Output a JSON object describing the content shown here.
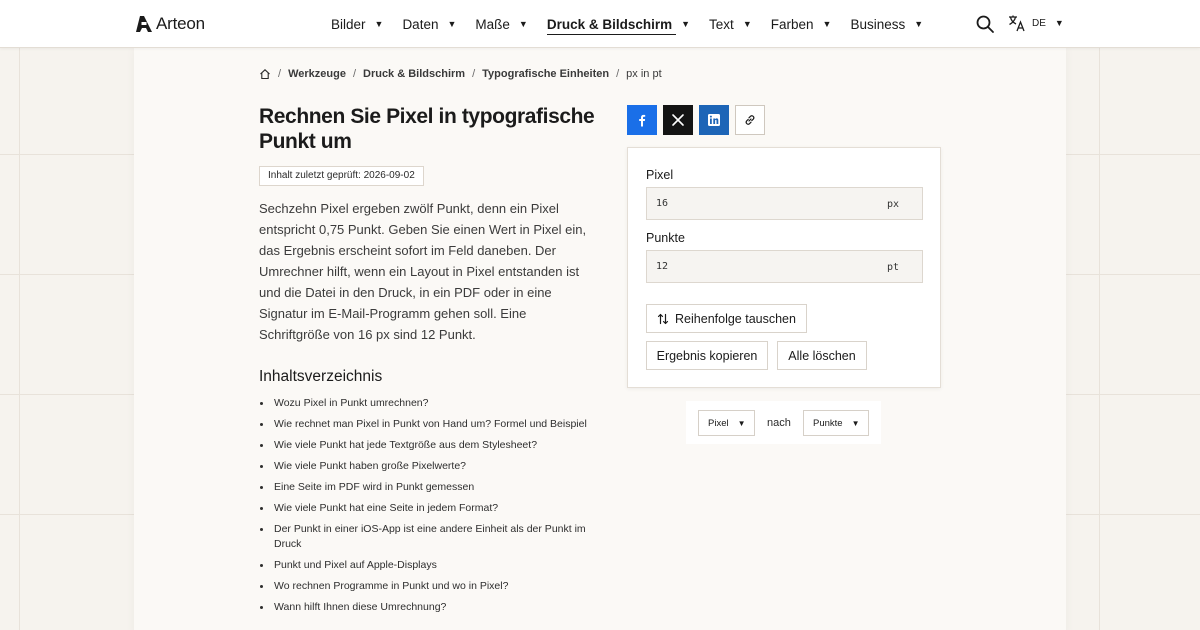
{
  "brand": {
    "name": "Arteon"
  },
  "nav": {
    "items": [
      {
        "label": "Bilder",
        "active": false
      },
      {
        "label": "Daten",
        "active": false
      },
      {
        "label": "Maße",
        "active": false
      },
      {
        "label": "Druck & Bildschirm",
        "active": true
      },
      {
        "label": "Text",
        "active": false
      },
      {
        "label": "Farben",
        "active": false
      },
      {
        "label": "Business",
        "active": false
      }
    ],
    "language": "DE"
  },
  "breadcrumb": {
    "items": [
      "Werkzeuge",
      "Druck & Bildschirm",
      "Typografische Einheiten"
    ],
    "current": "px in pt"
  },
  "article": {
    "title": "Rechnen Sie Pixel in typografische Punkt um",
    "review_badge": "Inhalt zuletzt geprüft: 2026-09-02",
    "intro": "Sechzehn Pixel ergeben zwölf Punkt, denn ein Pixel entspricht 0,75 Punkt. Geben Sie einen Wert in Pixel ein, das Ergebnis erscheint sofort im Feld daneben. Der Umrechner hilft, wenn ein Layout in Pixel entstanden ist und die Datei in den Druck, in ein PDF oder in eine Signatur im E-Mail-Programm gehen soll. Eine Schriftgröße von 16 px sind 12 Punkt."
  },
  "toc": {
    "title": "Inhaltsverzeichnis",
    "items": [
      "Wozu Pixel in Punkt umrechnen?",
      "Wie rechnet man Pixel in Punkt von Hand um? Formel und Beispiel",
      "Wie viele Punkt hat jede Textgröße aus dem Stylesheet?",
      "Wie viele Punkt haben große Pixelwerte?",
      "Eine Seite im PDF wird in Punkt gemessen",
      "Wie viele Punkt hat eine Seite in jedem Format?",
      "Der Punkt in einer iOS-App ist eine andere Einheit als der Punkt im Druck",
      "Punkt und Pixel auf Apple-Displays",
      "Wo rechnen Programme in Punkt und wo in Pixel?",
      "Wann hilft Ihnen diese Umrechnung?"
    ]
  },
  "share": {
    "icons": [
      "facebook-icon",
      "x-icon",
      "linkedin-icon",
      "link-icon"
    ]
  },
  "converter": {
    "from": {
      "label": "Pixel",
      "value": "16",
      "unit": "px"
    },
    "to": {
      "label": "Punkte",
      "value": "12",
      "unit": "pt"
    },
    "swap_label": "Reihenfolge tauschen",
    "copy_label": "Ergebnis kopieren",
    "clear_label": "Alle löschen"
  },
  "unit_select": {
    "from": "Pixel",
    "connector": "nach",
    "to": "Punkte"
  },
  "colors": {
    "background": "#f6f3ee",
    "facebook": "#1a6fe8",
    "x": "#141414",
    "linkedin": "#1d65b7"
  }
}
